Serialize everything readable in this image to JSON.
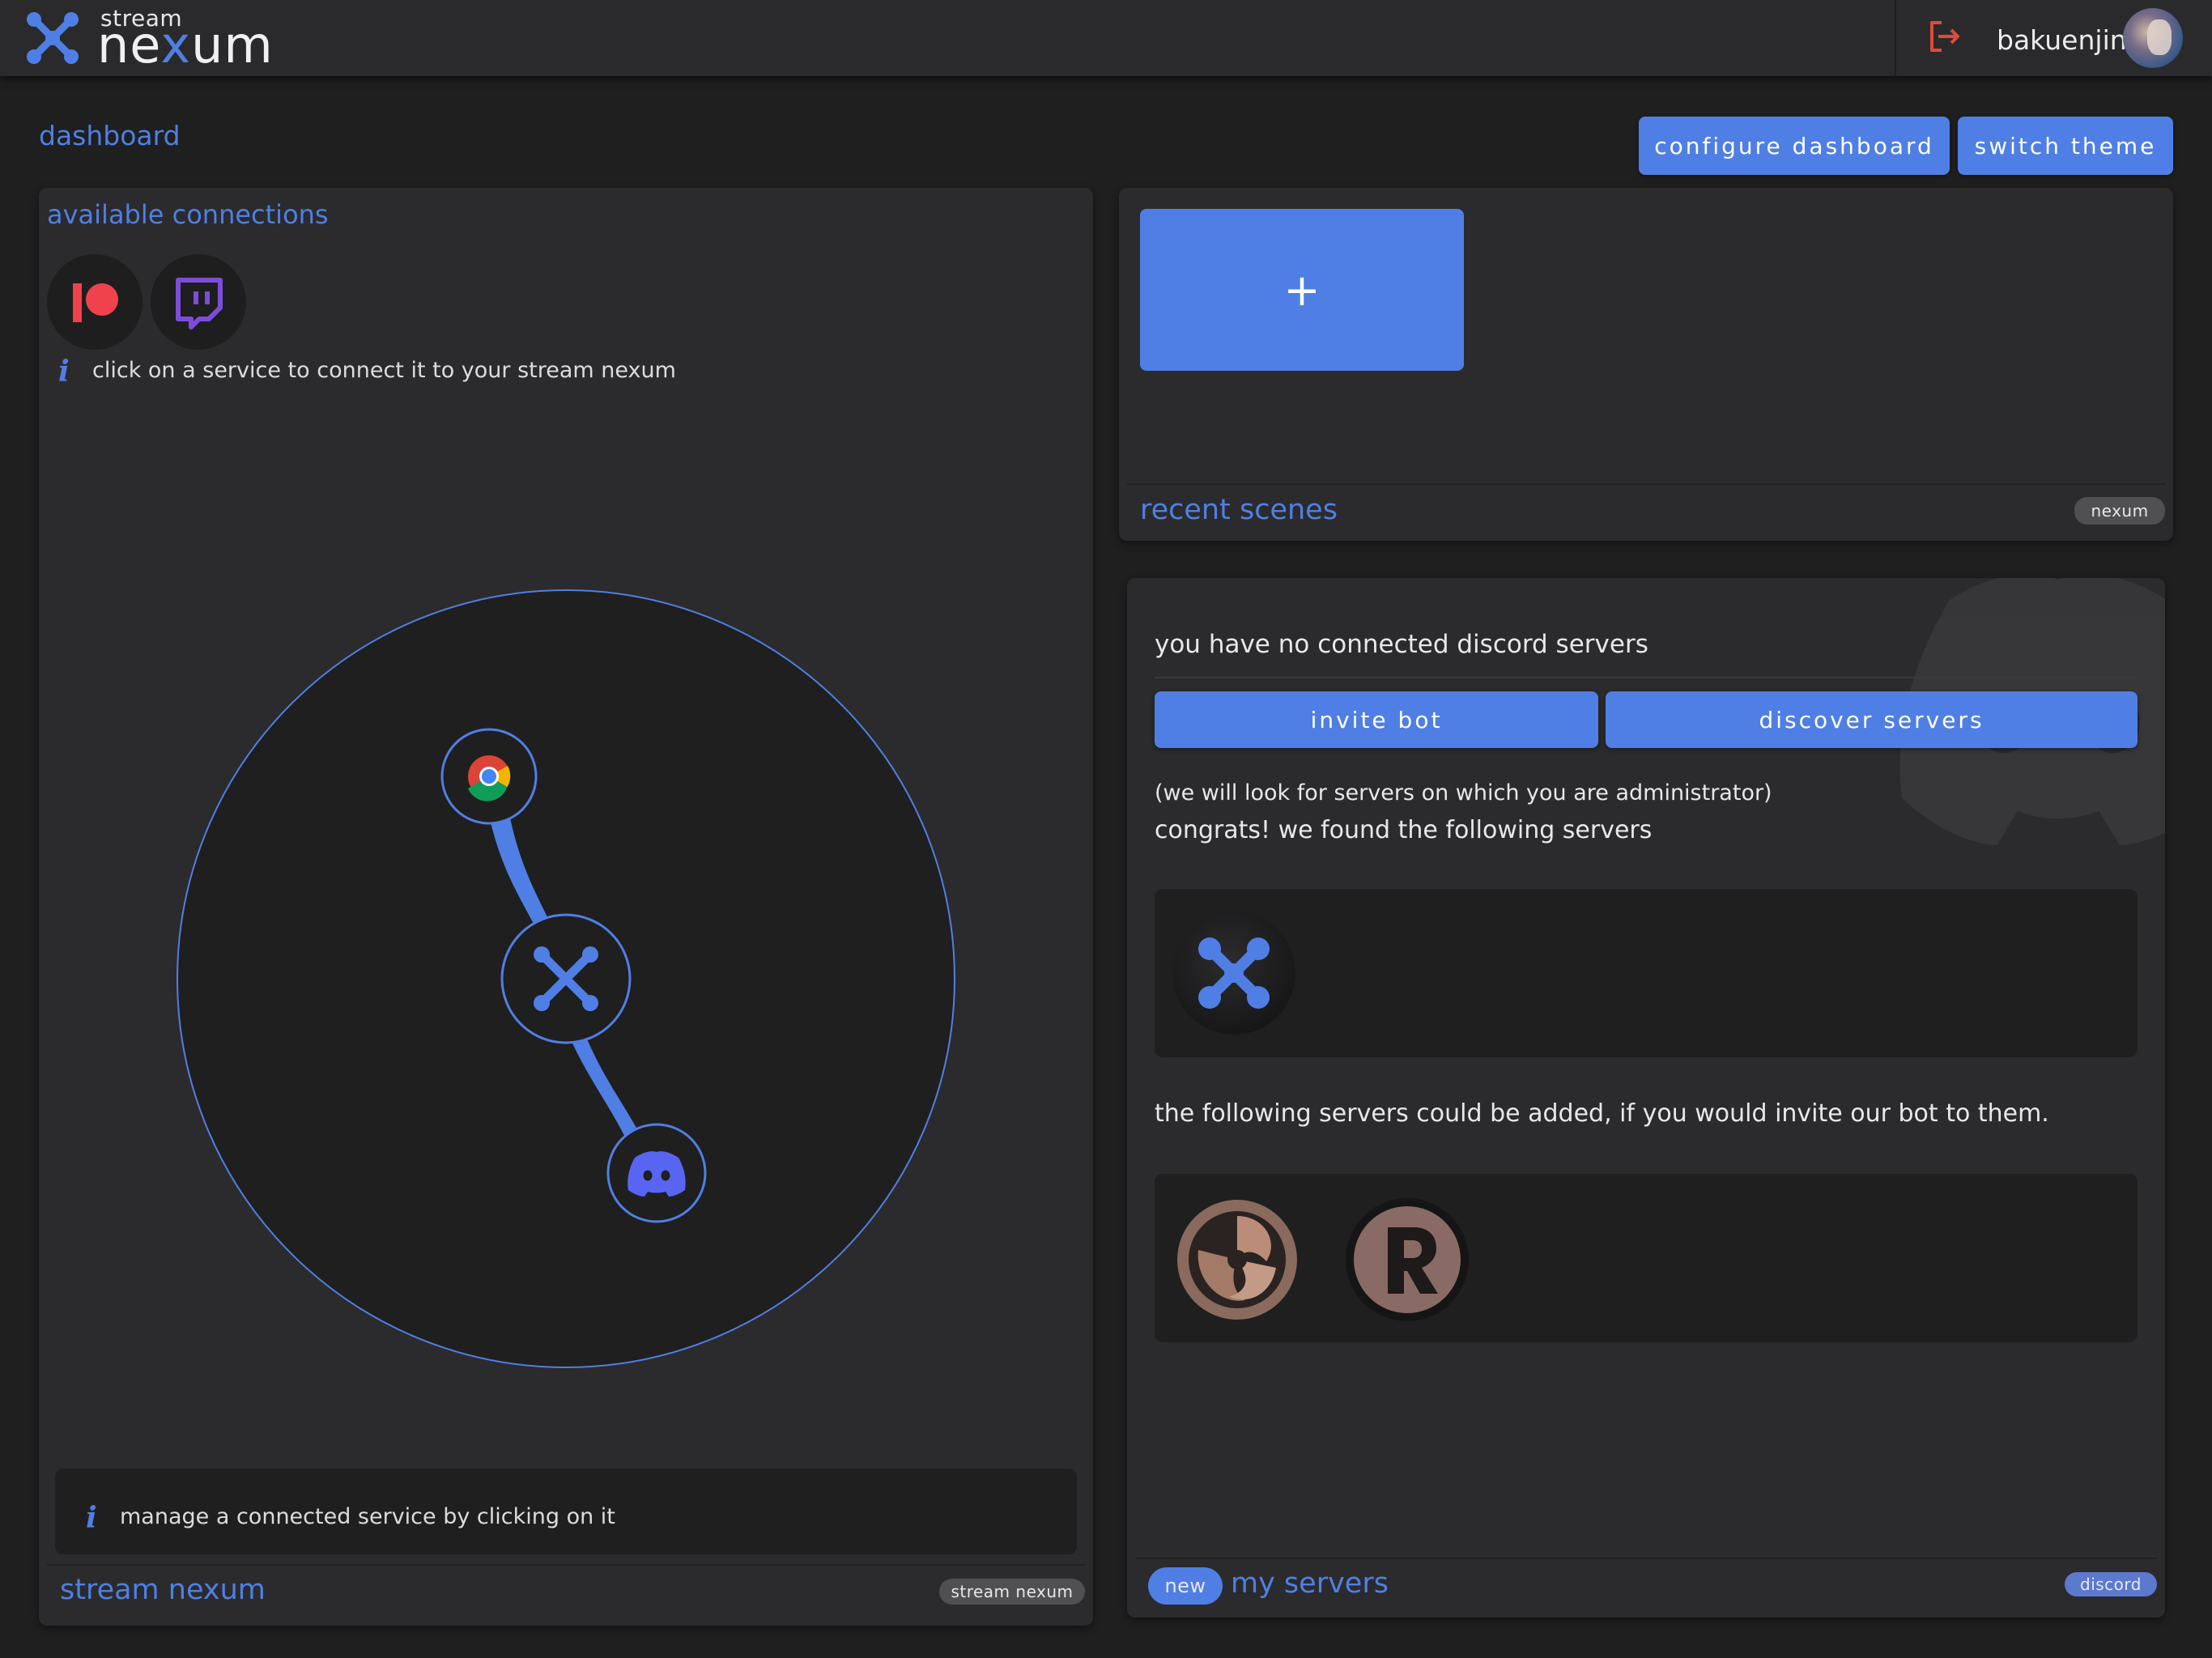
{
  "header": {
    "brand_top": "stream",
    "brand_pre": "ne",
    "brand_x": "x",
    "brand_post": "um",
    "username": "bakuenjin",
    "logout_icon": "logout-icon",
    "avatar": "user-avatar"
  },
  "page": {
    "title": "dashboard",
    "configure_label": "configure dashboard",
    "switch_theme_label": "switch theme"
  },
  "connections": {
    "title": "available connections",
    "services": [
      "patreon",
      "twitch"
    ],
    "hint": "click on a service to connect it to your stream nexum",
    "graph_nodes": [
      "chrome",
      "nexum",
      "discord"
    ],
    "manage_hint": "manage a connected service by clicking on it",
    "footer_title": "stream nexum",
    "footer_tag": "stream nexum"
  },
  "scenes": {
    "add_label": "+",
    "footer_title": "recent scenes",
    "footer_tag": "nexum"
  },
  "servers": {
    "no_servers": "you have no connected discord servers",
    "invite_label": "invite bot",
    "discover_label": "discover servers",
    "admin_note": "(we will look for servers on which you are administrator)",
    "found_text": "congrats! we found the following servers",
    "found": [
      "nexum-server"
    ],
    "addable_text": "the following servers could be added, if you would invite our bot to them.",
    "addable": [
      "osu-server",
      "r-server"
    ],
    "new_badge": "new",
    "footer_title": "my servers",
    "footer_tag": "discord"
  },
  "colors": {
    "accent": "#4f7fe4",
    "background": "#1f1f20",
    "card": "#2b2b2d",
    "patreon": "#f0424d",
    "twitch": "#7d4dd9",
    "discord": "#5865f2",
    "logout": "#e04a3a"
  }
}
